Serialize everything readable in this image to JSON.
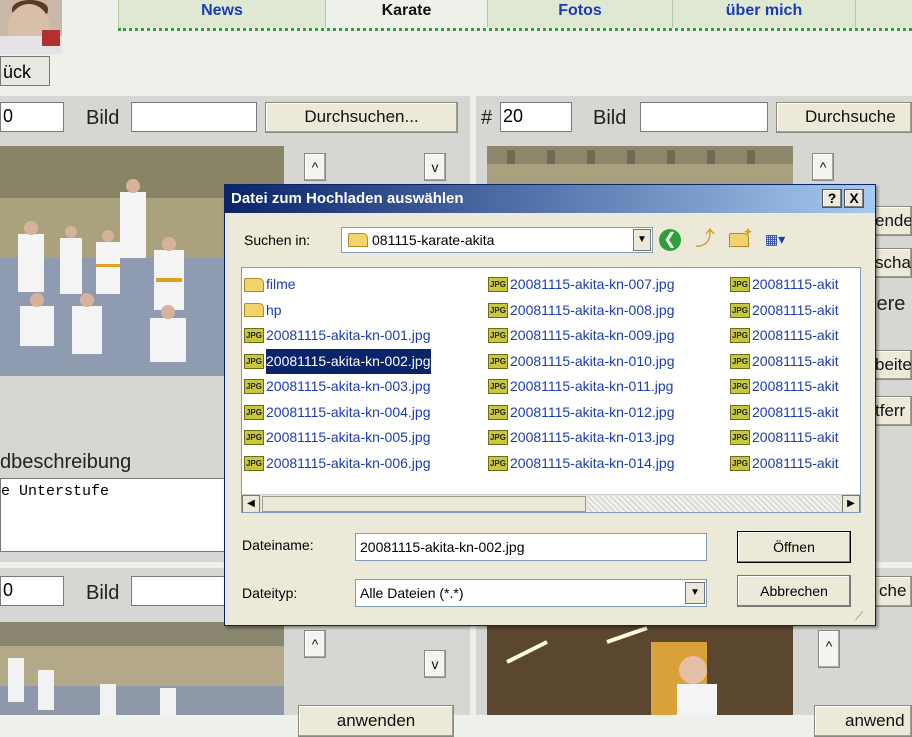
{
  "nav": {
    "tabs": [
      {
        "label": "News"
      },
      {
        "label": "Karate"
      },
      {
        "label": "Fotos"
      },
      {
        "label": "über mich"
      }
    ],
    "back_label": "ück"
  },
  "panel_left": {
    "number": "0",
    "bild_label": "Bild",
    "browse_label": "Durchsuchen...",
    "up_label": "^",
    "down_label": "v",
    "description_label": "dbeschreibung",
    "description_value": "e Unterstufe"
  },
  "panel_right": {
    "hash": "#",
    "number": "20",
    "bild_label": "Bild",
    "browse_label": "Durchsuche",
    "up_label": "^",
    "side_labels": [
      "ende",
      "scha",
      "iere",
      "beite",
      "tferr"
    ]
  },
  "panel_left_bottom": {
    "number": "0",
    "bild_label": "Bild",
    "up_label": "^",
    "down_label": "v",
    "apply_label": "anwenden"
  },
  "panel_right_bottom": {
    "browse_label": "che",
    "up_label": "^",
    "apply_label": "anwend"
  },
  "dialog": {
    "title": "Datei zum Hochladen auswählen",
    "help_btn": "?",
    "close_btn": "X",
    "lookin_label": "Suchen in:",
    "lookin_value": "081115-karate-akita",
    "files_col1": [
      {
        "name": "filme",
        "type": "folder"
      },
      {
        "name": "hp",
        "type": "folder"
      },
      {
        "name": "20081115-akita-kn-001.jpg",
        "type": "jpg"
      },
      {
        "name": "20081115-akita-kn-002.jpg",
        "type": "jpg",
        "selected": true
      },
      {
        "name": "20081115-akita-kn-003.jpg",
        "type": "jpg"
      },
      {
        "name": "20081115-akita-kn-004.jpg",
        "type": "jpg"
      },
      {
        "name": "20081115-akita-kn-005.jpg",
        "type": "jpg"
      },
      {
        "name": "20081115-akita-kn-006.jpg",
        "type": "jpg"
      }
    ],
    "files_col2": [
      {
        "name": "20081115-akita-kn-007.jpg",
        "type": "jpg"
      },
      {
        "name": "20081115-akita-kn-008.jpg",
        "type": "jpg"
      },
      {
        "name": "20081115-akita-kn-009.jpg",
        "type": "jpg"
      },
      {
        "name": "20081115-akita-kn-010.jpg",
        "type": "jpg"
      },
      {
        "name": "20081115-akita-kn-011.jpg",
        "type": "jpg"
      },
      {
        "name": "20081115-akita-kn-012.jpg",
        "type": "jpg"
      },
      {
        "name": "20081115-akita-kn-013.jpg",
        "type": "jpg"
      },
      {
        "name": "20081115-akita-kn-014.jpg",
        "type": "jpg"
      }
    ],
    "files_col3": [
      {
        "name": "20081115-akit",
        "type": "jpg"
      },
      {
        "name": "20081115-akit",
        "type": "jpg"
      },
      {
        "name": "20081115-akit",
        "type": "jpg"
      },
      {
        "name": "20081115-akit",
        "type": "jpg"
      },
      {
        "name": "20081115-akit",
        "type": "jpg"
      },
      {
        "name": "20081115-akit",
        "type": "jpg"
      },
      {
        "name": "20081115-akit",
        "type": "jpg"
      },
      {
        "name": "20081115-akit",
        "type": "jpg"
      }
    ],
    "filename_label": "Dateiname:",
    "filename_value": "20081115-akita-kn-002.jpg",
    "filetype_label": "Dateityp:",
    "filetype_value": "Alle Dateien (*.*)",
    "open_label": "Öffnen",
    "cancel_label": "Abbrechen",
    "icon_jpg_text": "JPG"
  }
}
